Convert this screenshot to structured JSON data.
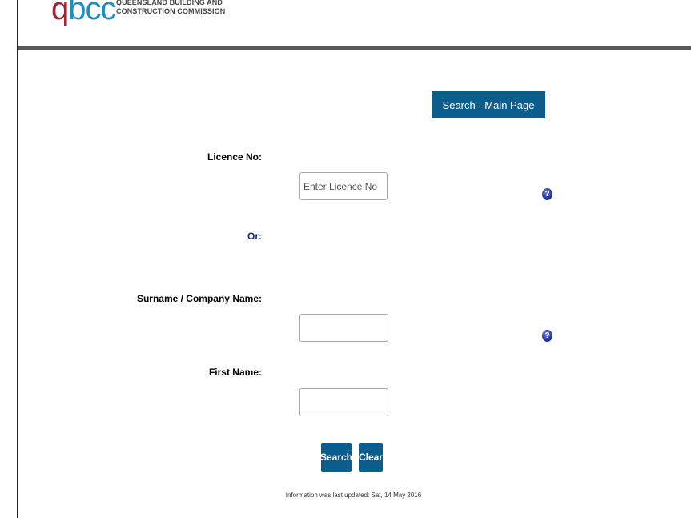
{
  "header": {
    "logo_q": "q",
    "logo_bcc": "bcc",
    "org_line1": "QUEENSLAND BUILDING AND",
    "org_line2": "CONSTRUCTION COMMISSION"
  },
  "nav": {
    "main_page_button": "Search - Main Page"
  },
  "form": {
    "licence_label": "Licence No:",
    "licence_placeholder": "Enter Licence No",
    "or_label": "Or:",
    "surname_label": "Surname / Company Name:",
    "first_name_label": "First Name:",
    "help_glyph": "?"
  },
  "actions": {
    "search": "Search",
    "clear": "Clear"
  },
  "footer": {
    "updated": "Information was last updated: Sat, 14 May 2016"
  },
  "colors": {
    "accent": "#0b5d8e",
    "brand_red": "#a31f34",
    "brand_blue": "#1c8fc1"
  }
}
